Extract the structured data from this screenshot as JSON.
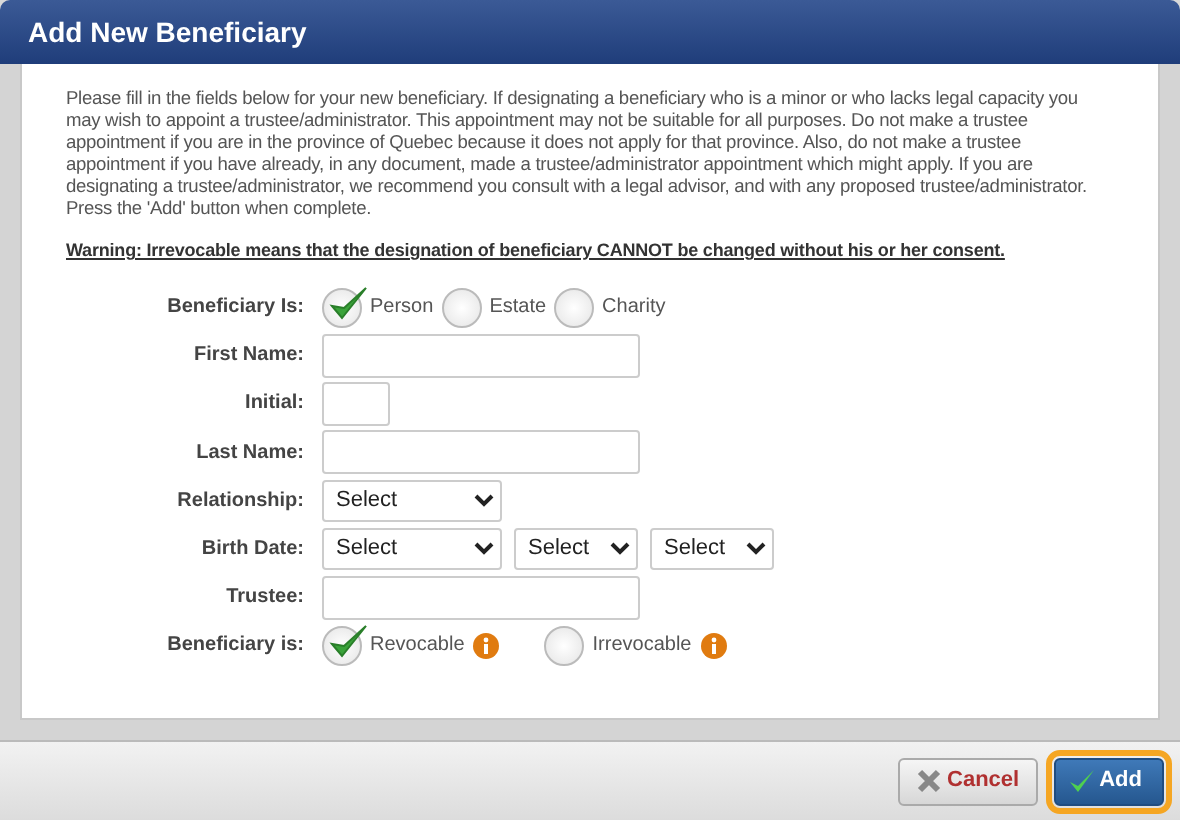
{
  "dialog": {
    "title": "Add New Beneficiary"
  },
  "intro": [
    "Please fill in the fields below for your new beneficiary. If designating a beneficiary who is a minor or who lacks legal capacity you may wish to appoint a trustee/administrator. This appointment may not be suitable for all purposes. Do not make a trustee appointment if you are in the province of Quebec because it does not apply for that province. Also, do not make a trustee appointment if you have already, in any document, made a trustee/administrator appointment which might apply. If you are designating a trustee/administrator, we recommend you consult with a legal advisor, and with any proposed trustee/administrator.",
    "Press the 'Add' button when complete."
  ],
  "warning": "Warning: Irrevocable means that the designation of beneficiary CANNOT be changed without his or her consent.",
  "form": [
    {
      "kind": "radio",
      "label": "Beneficiary Is:",
      "options": [
        {
          "label": "Person",
          "selected": true
        },
        {
          "label": "Estate",
          "selected": false
        },
        {
          "label": "Charity",
          "selected": false
        }
      ]
    },
    {
      "kind": "text",
      "label": "First Name:"
    },
    {
      "kind": "short_text",
      "label": "Initial:"
    },
    {
      "kind": "text",
      "label": "Last Name:"
    },
    {
      "kind": "select",
      "label": "Relationship:",
      "selects": [
        "Select"
      ]
    },
    {
      "kind": "select",
      "label": "Birth Date:",
      "selects": [
        "Select",
        "Select",
        "Select"
      ]
    },
    {
      "kind": "text",
      "label": "Trustee:"
    },
    {
      "kind": "radio",
      "label": "Beneficiary is:",
      "options": [
        {
          "label": "Revocable",
          "selected": true,
          "info": true
        },
        {
          "label": "Irrevocable",
          "selected": false,
          "info": true
        }
      ]
    }
  ],
  "buttons": [
    {
      "kind": "cancel",
      "label": "Cancel",
      "focused": false
    },
    {
      "kind": "add",
      "label": "Add",
      "focused": true
    }
  ]
}
